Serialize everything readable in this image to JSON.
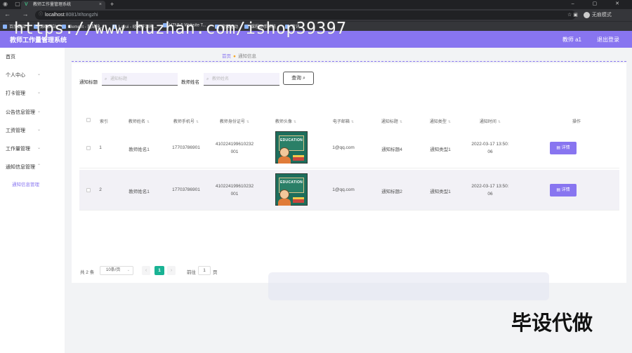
{
  "browser": {
    "tab_title": "教师工作量管理系统",
    "tab_close": "×",
    "new_tab": "+",
    "url_host": "localhost",
    "url_rest": ":8081/#/tongzhi",
    "profile_label": "无痕模式",
    "bookmarks": [
      "百度翻译",
      "源码网站",
      "Element - 网站快...",
      "Layui - 经典开源模...",
      "HTML5 Website T...",
      "搜索驱动",
      "课程助手系统",
      "资讯"
    ]
  },
  "header": {
    "title": "教师工作量管理系统",
    "user": "教师 a1",
    "logout": "退出登录"
  },
  "sidebar": {
    "items": [
      {
        "label": "首页",
        "has_children": false
      },
      {
        "label": "个人中心",
        "has_children": true
      },
      {
        "label": "打卡管理",
        "has_children": true
      },
      {
        "label": "公告信息管理",
        "has_children": true
      },
      {
        "label": "工资管理",
        "has_children": true
      },
      {
        "label": "工作量管理",
        "has_children": true
      },
      {
        "label": "通知信息管理",
        "has_children": true
      }
    ],
    "sub_item": "通知信息管理"
  },
  "breadcrumb": {
    "home": "首页",
    "current": "通知信息"
  },
  "search": {
    "title_label": "通知标题",
    "title_placeholder": "通知标题",
    "name_label": "教师姓名",
    "name_placeholder": "教师姓名",
    "button": "查询"
  },
  "table": {
    "headers": [
      "索引",
      "教师姓名",
      "教师手机号",
      "教师身份证号",
      "教师头像",
      "电子邮箱",
      "通知标题",
      "通知类型",
      "通知时间",
      "操作"
    ],
    "avatar_word": "EDUCATION",
    "action_label": "详情",
    "rows": [
      {
        "index": "1",
        "name": "教师姓名1",
        "phone": "17703786901",
        "id_line1": "410224199610232",
        "id_line2": "001",
        "email": "1@qq.com",
        "title": "通知标题4",
        "type": "通知类型1",
        "time_line1": "2022-03-17 13:50:",
        "time_line2": "06"
      },
      {
        "index": "2",
        "name": "教师姓名1",
        "phone": "17703786901",
        "id_line1": "410224199610232",
        "id_line2": "001",
        "email": "1@qq.com",
        "title": "通知标题2",
        "type": "通知类型1",
        "time_line1": "2022-03-17 13:50:",
        "time_line2": "06"
      }
    ]
  },
  "pagination": {
    "total": "共 2 条",
    "page_size": "10条/页",
    "prev": "‹",
    "current_page": "1",
    "next": "›",
    "goto_label": "前往",
    "goto_value": "1",
    "goto_suffix": "页"
  },
  "watermarks": {
    "top": "https://www.huzhan.com/ishop39397",
    "bottom": "毕设代做"
  },
  "colors": {
    "accent": "#8875f0",
    "page_active": "#19b394"
  }
}
